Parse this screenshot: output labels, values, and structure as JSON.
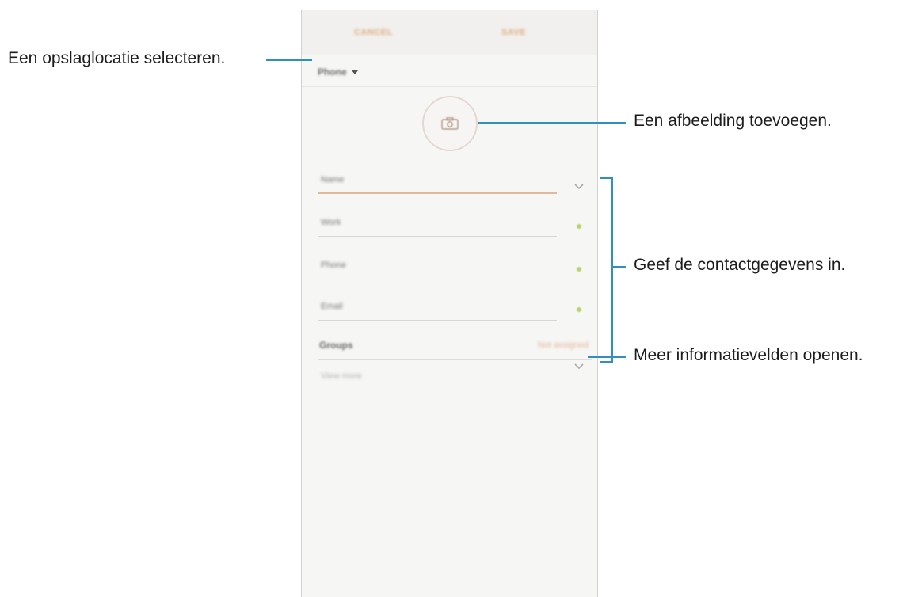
{
  "phone": {
    "cancel_label": "CANCEL",
    "save_label": "SAVE",
    "storage_location": "Phone",
    "fields": {
      "name_placeholder": "Name",
      "work_placeholder": "Work",
      "phone_placeholder": "Phone",
      "email_placeholder": "Email"
    },
    "groups_label": "Groups",
    "groups_value": "Not assigned",
    "view_more_label": "View more"
  },
  "callouts": {
    "storage": "Een opslaglocatie selecteren.",
    "image": "Een afbeelding toevoegen.",
    "contact_info": "Geef de contactgegevens in.",
    "more_fields": "Meer informatievelden openen."
  },
  "colors": {
    "accent": "#e0a87a",
    "leader_line": "#2f8fbf",
    "add_dot": "#b7d46b"
  }
}
